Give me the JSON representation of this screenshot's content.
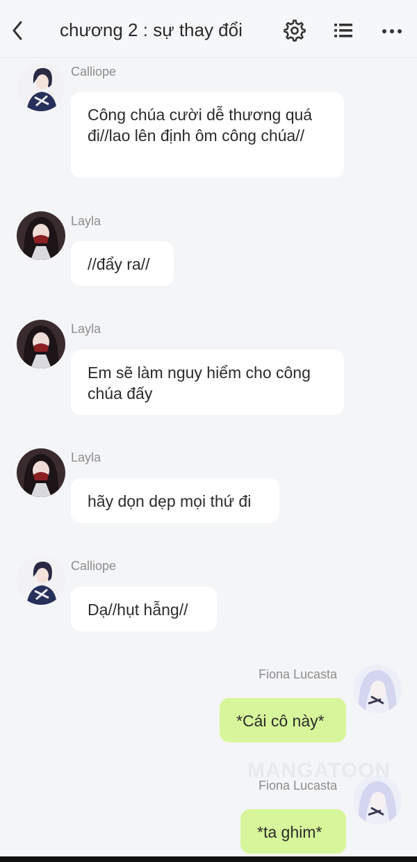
{
  "header": {
    "title": "chương 2 : sự thay đổi",
    "icons": [
      "back-icon",
      "gear-icon",
      "list-icon",
      "more-icon"
    ]
  },
  "messages": [
    {
      "sender": "Calliope",
      "text": "Công chúa cười dễ thương quá đi//lao lên định ôm công chúa//",
      "side": "left",
      "avatar": "calliope-avatar"
    },
    {
      "sender": "Layla",
      "text": "//đẩy ra//",
      "side": "left",
      "avatar": "layla-avatar"
    },
    {
      "sender": "Layla",
      "text": "Em sẽ làm nguy hiểm cho công chúa đấy",
      "side": "left",
      "avatar": "layla-avatar"
    },
    {
      "sender": "Layla",
      "text": "hãy dọn dẹp mọi thứ đi",
      "side": "left",
      "avatar": "layla-avatar"
    },
    {
      "sender": "Calliope",
      "text": "Dạ//hụt hẫng//",
      "side": "left",
      "avatar": "calliope-avatar"
    },
    {
      "sender": "Fiona Lucasta",
      "text": "*Cái cô này*",
      "side": "right",
      "avatar": "fiona-avatar"
    },
    {
      "sender": "Fiona Lucasta",
      "text": "*ta ghim*",
      "side": "right",
      "avatar": "fiona-avatar"
    }
  ],
  "watermark": "MANGATOON",
  "colors": {
    "background": "#f4f5f7",
    "bubble_other": "#ffffff",
    "bubble_self": "#d7f59a",
    "name": "#8d8d8d"
  }
}
